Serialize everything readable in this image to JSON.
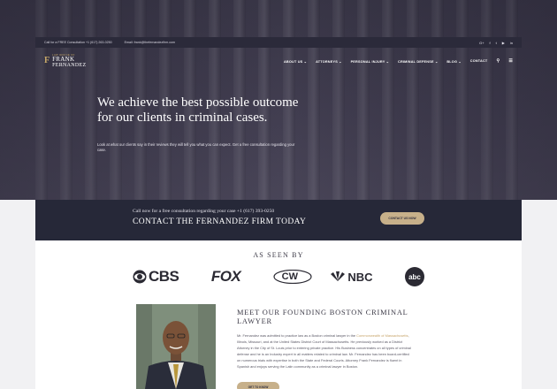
{
  "topbar": {
    "phone": "Call for a FREE Consultation +1 (617) 263-0250",
    "email": "Email: frank@thefernandezfirm.com",
    "social": [
      "G+",
      "f",
      "t",
      "▶",
      "in"
    ]
  },
  "logo": {
    "small": "LAW OFFICE OF",
    "name_line1": "FRANK",
    "name_line2": "FERNANDEZ",
    "suffix": "LLC"
  },
  "nav": {
    "items": [
      "ABOUT US ⌄",
      "ATTORNEYS ⌄",
      "PERSONAL INJURY ⌄",
      "CRIMINAL DEFENSE ⌄",
      "BLOG ⌄",
      "CONTACT"
    ]
  },
  "hero": {
    "title": "We achieve the best possible outcome for our clients in criminal cases.",
    "subtitle": "Look at what our clients say in their reviews they will tell you what you can expect. Get a free consultation regarding your case."
  },
  "cta": {
    "small": "Call now for a free consultation regarding your case +1 (617) 393-0250",
    "big": "CONTACT THE FERNANDEZ FIRM TODAY",
    "button": "CONTACT US NOW"
  },
  "as_seen_by": {
    "title": "AS SEEN BY",
    "logos": [
      "CBS",
      "FOX",
      "CW",
      "NBC",
      "abc"
    ]
  },
  "about": {
    "title": "MEET OUR FOUNDING BOSTON CRIMINAL LAWYER",
    "body_part1": "Mr. Fernandez was admitted to practice law as a Boston criminal lawyer in the ",
    "body_link": "Commonwealth of Massachusetts",
    "body_part2": ", Illinois, Missouri, and at the United States District Court of Massachusetts. He previously worked as a District Attorney in the City of St. Louis prior to entering private practice. His Business concentrates on all types of criminal defense and he is an Industry expert in all matters related to criminal law. Mr. Fernandez has been board-certified on numerous trials with expertise in both the State and Federal Courts. Attorney Frank Fernandez is fluent in Spanish and enjoys serving the Latin community as a criminal lawyer in Boston.",
    "button": "GET TO KNOW"
  }
}
